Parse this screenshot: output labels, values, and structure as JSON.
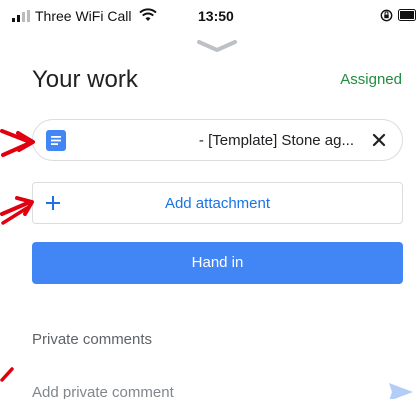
{
  "status_bar": {
    "carrier": "Three WiFi Call",
    "time": "13:50"
  },
  "header": {
    "title": "Your work",
    "status": "Assigned"
  },
  "attachment": {
    "name": "- [Template] Stone ag..."
  },
  "add_attachment": {
    "label": "Add attachment"
  },
  "hand_in": {
    "label": "Hand in"
  },
  "private_comments": {
    "title": "Private comments",
    "placeholder": "Add private comment"
  },
  "icons": {
    "signal": "signal-bars-icon",
    "wifi": "wifi-icon",
    "orientation_lock": "orientation-lock-icon",
    "battery": "battery-icon",
    "handle": "chevron-down-icon",
    "doc": "google-docs-icon",
    "close": "close-icon",
    "plus": "plus-icon",
    "send": "send-icon",
    "annotation": "red-arrow-icon"
  },
  "colors": {
    "accent_blue": "#1a73e8",
    "hand_in_bg": "#4285f4",
    "assigned_green": "#1e8e3e",
    "doc_icon_blue": "#4285f4",
    "annotation_red": "#e0000f"
  }
}
